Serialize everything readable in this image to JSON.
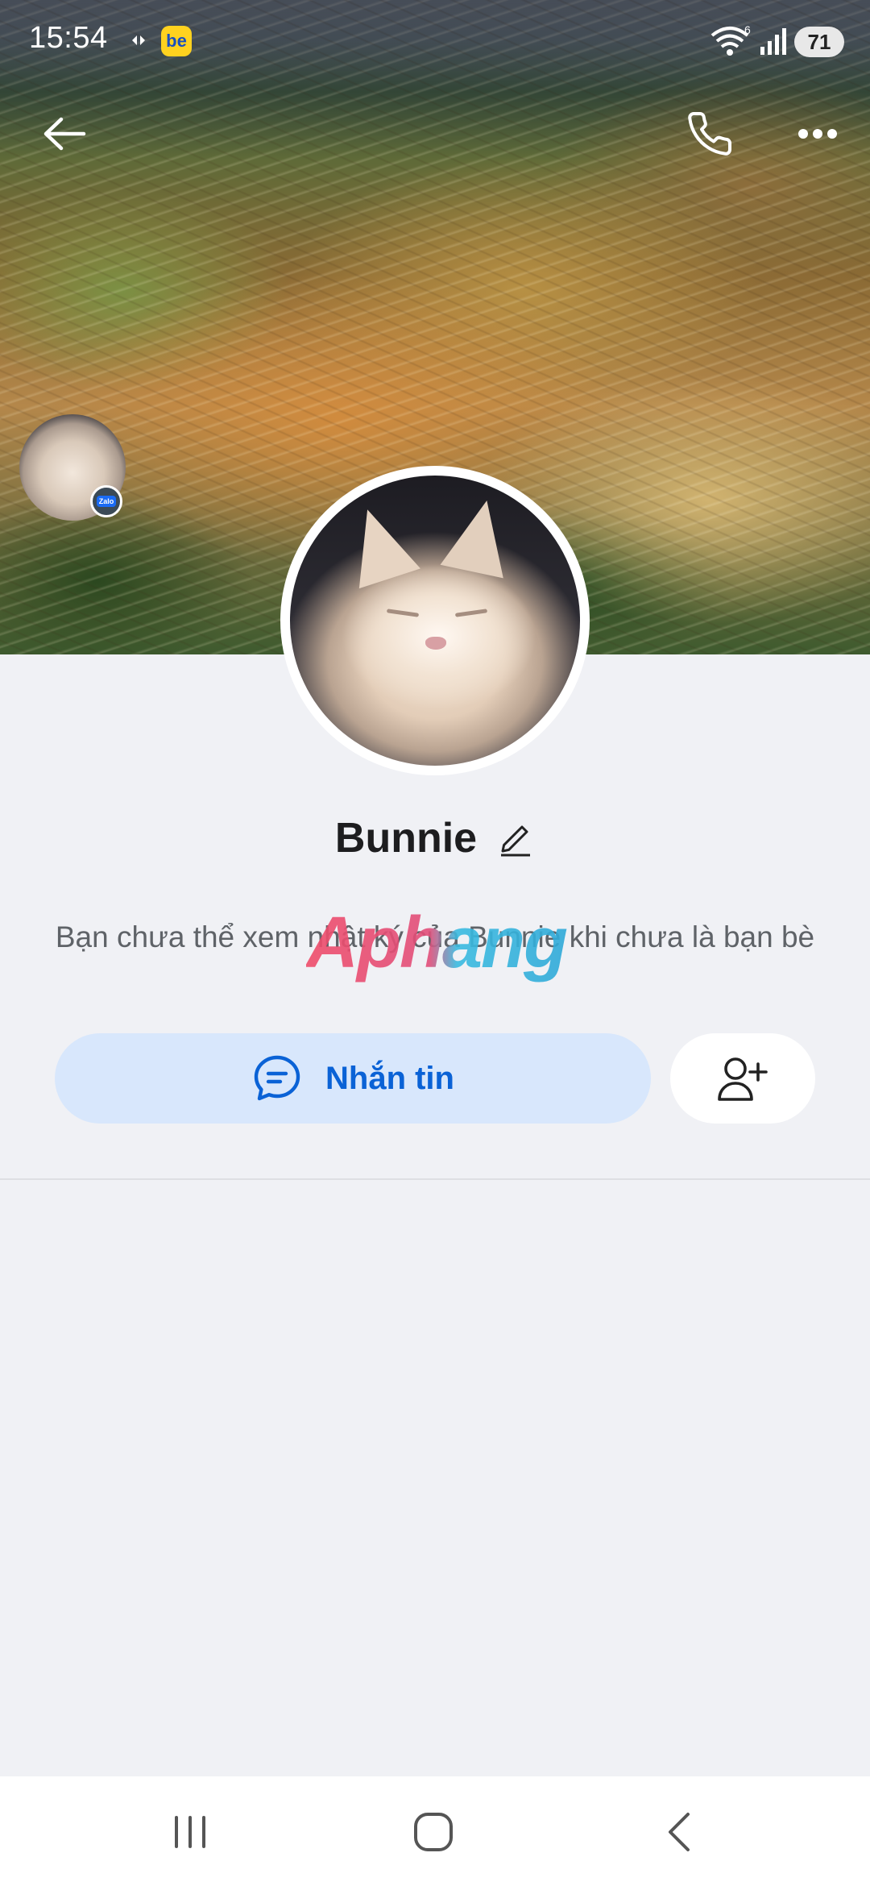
{
  "status_bar": {
    "time": "15:54",
    "app_badge": "be",
    "wifi_badge": "6",
    "battery": "71"
  },
  "top_bar": {
    "back_icon": "arrow-left-icon",
    "call_icon": "phone-icon",
    "more_icon": "more-horizontal-icon"
  },
  "profile": {
    "name": "Bunnie",
    "zalo_badge": "Zalo",
    "info_text": "Bạn chưa thể xem nhật ký của Bunnie khi chưa là bạn bè",
    "watermark": "Aphang"
  },
  "actions": {
    "message_label": "Nhắn tin",
    "message_icon": "chat-bubble-icon",
    "add_friend_icon": "add-user-icon"
  },
  "colors": {
    "accent": "#0a62d6",
    "message_bg": "#d8e7fc",
    "page_bg": "#f0f1f5"
  },
  "nav_bar": {
    "recents_icon": "recents-icon",
    "home_icon": "home-icon",
    "back_icon": "nav-back-icon"
  }
}
